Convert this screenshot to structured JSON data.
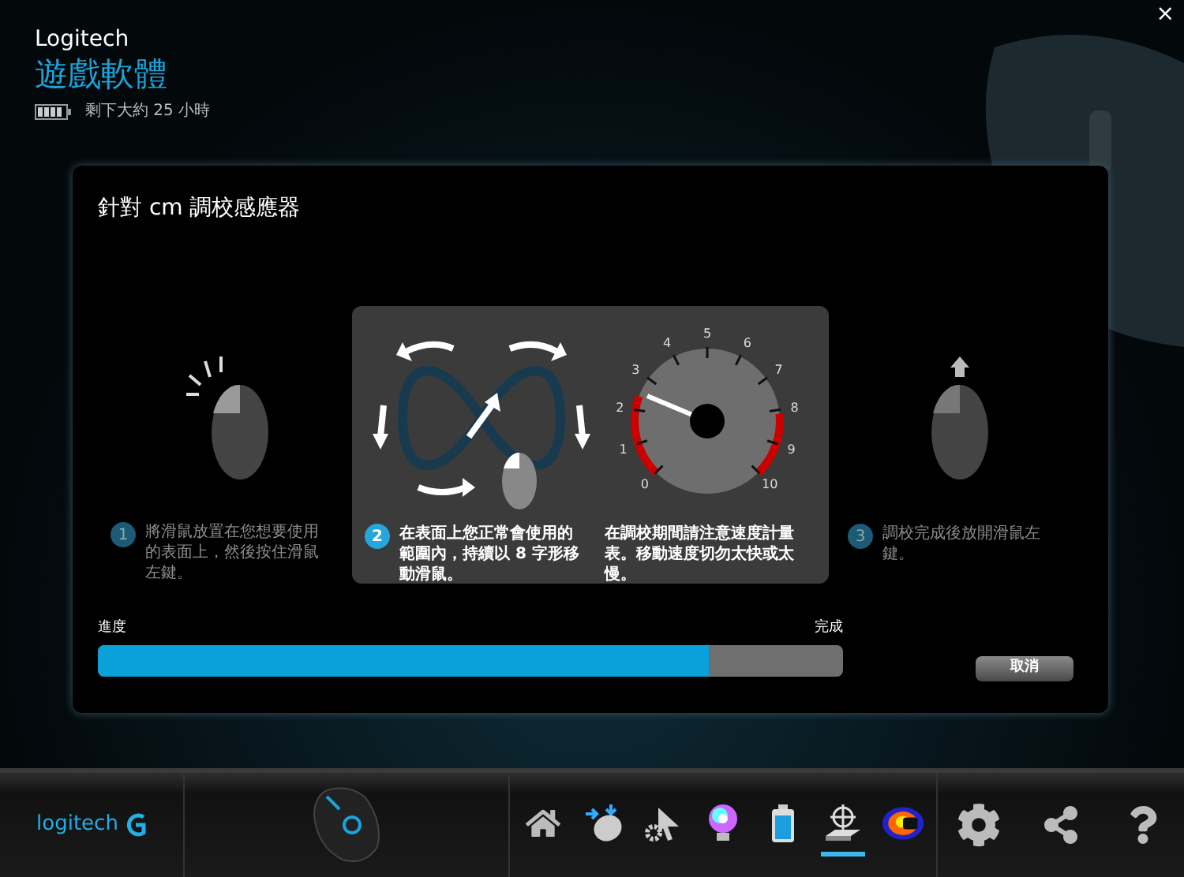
{
  "window": {
    "close": "×"
  },
  "header": {
    "brand": "Logitech",
    "title": "遊戲軟體",
    "battery_text": "剩下大約 25 小時"
  },
  "dialog": {
    "title": "針對 cm 調校感應器",
    "steps": [
      {
        "kind": "press",
        "number": "1",
        "text": "將滑鼠放置在您想要使用的表面上，然後按住滑鼠左鍵。",
        "selected": false
      },
      {
        "kind": "move",
        "number": "2",
        "text": "在表面上您正常會使用的範圍內，持續以 8 字形移動滑鼠。",
        "note": "在調校期間請注意速度計量表。移動速度切勿太快或太慢。",
        "gauge_labels": [
          "0",
          "1",
          "2",
          "3",
          "4",
          "5",
          "6",
          "7",
          "8",
          "9",
          "10"
        ],
        "selected": true
      },
      {
        "kind": "release",
        "number": "3",
        "text": "調校完成後放開滑鼠左鍵。",
        "selected": false
      }
    ],
    "progress": {
      "label": "進度",
      "end_label": "完成",
      "level": 0.82
    },
    "cancel": "取消"
  },
  "footer": {
    "logo": "logitech",
    "toolbar": [
      {
        "kind": "home",
        "selected": false
      },
      {
        "kind": "buttons",
        "selected": false
      },
      {
        "kind": "pointer",
        "selected": false
      },
      {
        "kind": "lighting",
        "selected": false
      },
      {
        "kind": "battery",
        "selected": false
      },
      {
        "kind": "surface",
        "selected": true
      },
      {
        "kind": "heatmap",
        "selected": false
      }
    ],
    "settings": [
      {
        "kind": "gear"
      },
      {
        "kind": "share"
      },
      {
        "kind": "help"
      }
    ]
  }
}
